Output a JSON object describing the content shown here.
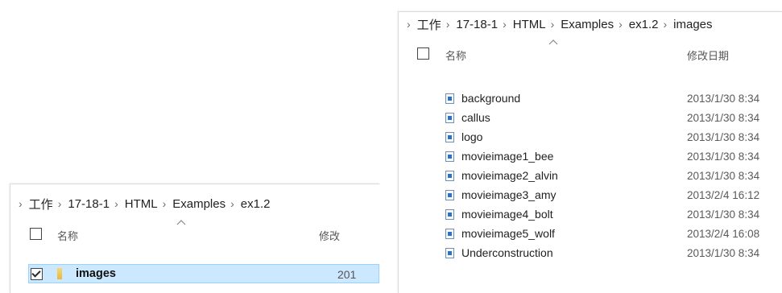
{
  "left_window": {
    "breadcrumb": [
      "工作",
      "17-18-1",
      "HTML",
      "Examples",
      "ex1.2"
    ],
    "header": {
      "name": "名称",
      "date": "修改"
    },
    "folder": {
      "name": "images",
      "date": "201",
      "checked": true
    }
  },
  "right_window": {
    "breadcrumb": [
      "工作",
      "17-18-1",
      "HTML",
      "Examples",
      "ex1.2",
      "images"
    ],
    "header": {
      "name": "名称",
      "date": "修改日期"
    },
    "files": [
      {
        "name": "background",
        "date": "2013/1/30 8:34"
      },
      {
        "name": "callus",
        "date": "2013/1/30 8:34"
      },
      {
        "name": "logo",
        "date": "2013/1/30 8:34"
      },
      {
        "name": "movieimage1_bee",
        "date": "2013/1/30 8:34"
      },
      {
        "name": "movieimage2_alvin",
        "date": "2013/1/30 8:34"
      },
      {
        "name": "movieimage3_amy",
        "date": "2013/2/4 16:12"
      },
      {
        "name": "movieimage4_bolt",
        "date": "2013/1/30 8:34"
      },
      {
        "name": "movieimage5_wolf",
        "date": "2013/2/4 16:08"
      },
      {
        "name": "Underconstruction",
        "date": "2013/1/30 8:34"
      }
    ]
  },
  "icons": {
    "crumb_separator": "chevron-right-icon",
    "sort": "sort-up-chevron-icon",
    "file": "image-file-icon",
    "folder": "folder-icon"
  },
  "colors": {
    "selected_row_bg": "#cce8ff",
    "selected_row_border": "#99d1ff",
    "file_icon_blue": "#2d6fc4",
    "folder_yellow": "#f7d774"
  }
}
